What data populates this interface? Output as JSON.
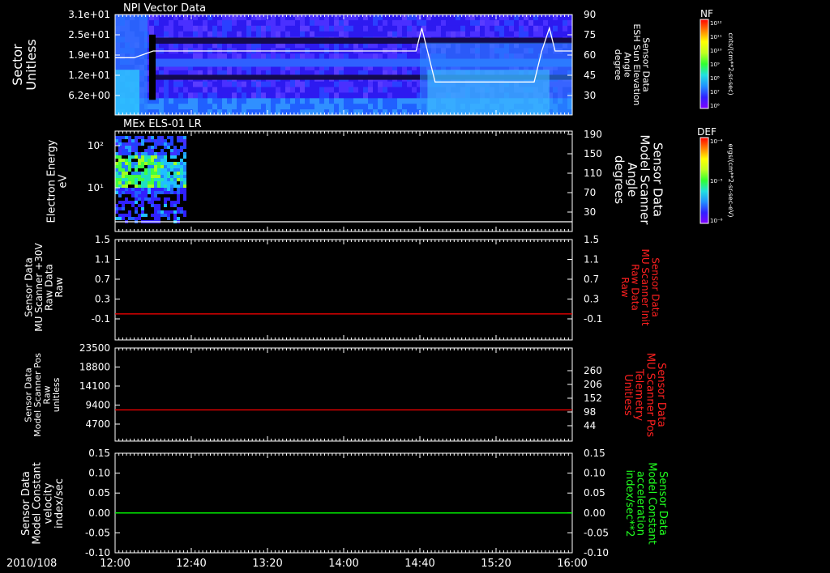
{
  "chart_data": [
    {
      "type": "heatmap",
      "title": "NPI Vector Data",
      "ylabel": "Sector\nUnitless",
      "y_ticks": [
        "3.1e+01",
        "2.5e+01",
        "1.9e+01",
        "1.2e+01",
        "6.2e+00"
      ],
      "y2label": "Sensor Data\nESH Sun Elevation\nAngle\ndegree",
      "y2_ticks": [
        "90",
        "75",
        "60",
        "45",
        "30"
      ],
      "y2lim": [
        15,
        90
      ],
      "series": [
        {
          "x": [
            "12:00",
            "12:10",
            "12:20",
            "14:38",
            "14:41",
            "14:44",
            "14:48",
            "15:40",
            "15:44",
            "15:48",
            "15:51",
            "16:00"
          ],
          "values": [
            58,
            58,
            63,
            63,
            80,
            63,
            40,
            40,
            63,
            80,
            63,
            63
          ]
        }
      ],
      "colorbar": {
        "label": "NF",
        "unit": "cnts/(cm**2-sr-sec)",
        "ticks": [
          "10¹²",
          "10¹¹",
          "10¹⁰",
          "10⁹",
          "10⁸",
          "10⁷",
          "10⁶"
        ]
      }
    },
    {
      "type": "heatmap",
      "title": "MEx ELS-01 LR",
      "ylabel": "Electron Energy\neV",
      "y_ticks": [
        "10²",
        "10¹"
      ],
      "y2label": "Sensor Data\nModel Scanner\nAngle\ndegrees",
      "y2_ticks": [
        "190",
        "150",
        "110",
        "70",
        "30"
      ],
      "y2lim": [
        0,
        190
      ],
      "series": [
        {
          "x": [
            "12:00",
            "16:00"
          ],
          "values": [
            10,
            10
          ]
        }
      ],
      "colorbar": {
        "label": "DEF",
        "unit": "ergs/(cm**2-sr-sec-eV)",
        "ticks": [
          "10⁻⁴",
          "10⁻⁵",
          "10⁻⁶"
        ]
      }
    },
    {
      "type": "line",
      "ylabel": "Sensor Data\nMU Scanner +30V\nRaw Data\nRaw",
      "y_ticks": [
        "1.5",
        "1.1",
        "0.7",
        "0.3",
        "-0.1"
      ],
      "ylim": [
        -0.5,
        1.5
      ],
      "y2label": "Sensor Data\nMU Scanner Init\nRaw Data\nRaw",
      "y2_ticks": [
        "1.5",
        "1.1",
        "0.7",
        "0.3",
        "-0.1"
      ],
      "line_color": "#ff0000",
      "series": [
        {
          "x": [
            "12:00",
            "16:00"
          ],
          "values": [
            0.0,
            0.0
          ]
        }
      ]
    },
    {
      "type": "line",
      "ylabel": "Sensor Data\nModel Scanner Pos\nRaw\nunitless",
      "y_ticks": [
        "23500",
        "18800",
        "14100",
        "9400",
        "4700"
      ],
      "y2label": "Sensor Data\nMU Scanner Pos\nTelemetry\nUnitless",
      "y2_ticks": [
        "260",
        "206",
        "152",
        "98",
        "44"
      ],
      "ylim": [
        0,
        23500
      ],
      "line_color": "#ff0000",
      "series": [
        {
          "x": [
            "12:00",
            "16:00"
          ],
          "values": [
            8200,
            8200
          ]
        }
      ]
    },
    {
      "type": "line",
      "ylabel": "Sensor Data\nModel Constant\nvelocity\nindex/sec",
      "y_ticks": [
        "0.15",
        "0.10",
        "0.05",
        "0.00",
        "-0.05",
        "-0.10"
      ],
      "ylim": [
        -0.1,
        0.15
      ],
      "y2label": "Sensor Data\nModel Constant\nacceleration\nindex/sec**2",
      "y2_ticks": [
        "0.15",
        "0.10",
        "0.05",
        "0.00",
        "-0.05",
        "-0.10"
      ],
      "line_color": "#00ff00",
      "series": [
        {
          "x": [
            "12:00",
            "16:00"
          ],
          "values": [
            0.0,
            0.0
          ]
        }
      ]
    }
  ],
  "x_axis": {
    "date": "2010/108",
    "ticks": [
      "12:00",
      "12:40",
      "13:20",
      "14:00",
      "14:40",
      "15:20",
      "16:00"
    ],
    "range": [
      "12:00",
      "16:00"
    ]
  },
  "colors": {
    "background": "#000000",
    "axis": "#ffffff",
    "red_line": "#ff0000",
    "green_line": "#00ff00",
    "purple": "#2200ee",
    "blue": "#2244ff"
  }
}
